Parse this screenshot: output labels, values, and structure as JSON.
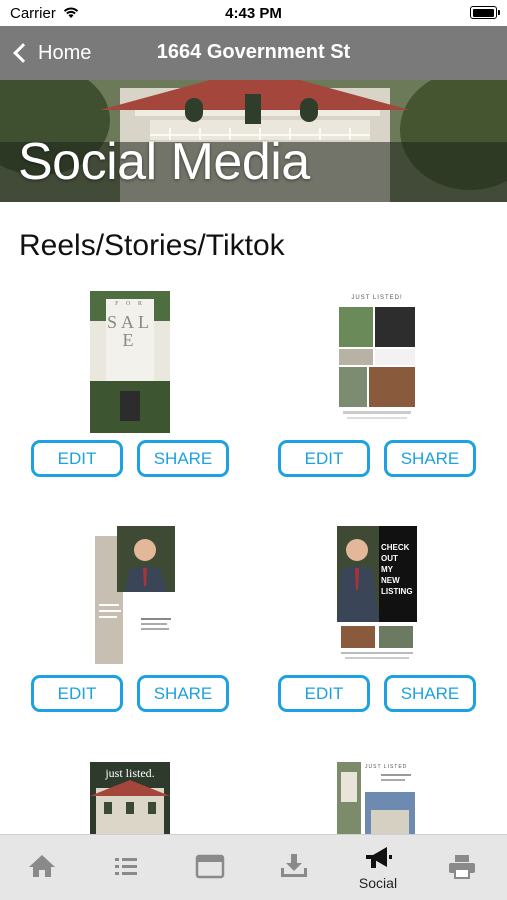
{
  "status_bar": {
    "carrier": "Carrier",
    "time": "4:43 PM",
    "battery_level": 1.0
  },
  "nav": {
    "back_label": "Home",
    "title": "1664 Government St"
  },
  "hero": {
    "title": "Social Media"
  },
  "section": {
    "heading": "Reels/Stories/Tiktok"
  },
  "cards": [
    {
      "edit_label": "EDIT",
      "share_label": "SHARE",
      "thumb_text_1": "F O R",
      "thumb_text_2": "SALE"
    },
    {
      "edit_label": "EDIT",
      "share_label": "SHARE",
      "thumb_text_1": "JUST LISTED!"
    },
    {
      "edit_label": "EDIT",
      "share_label": "SHARE"
    },
    {
      "edit_label": "EDIT",
      "share_label": "SHARE",
      "thumb_text_1": "CHECK OUT MY NEW LISTING"
    },
    {
      "thumb_text_1": "just listed."
    },
    {
      "thumb_text_1": "JUST LISTED"
    }
  ],
  "tab_bar": {
    "tabs": [
      {
        "icon": "home-icon",
        "label": ""
      },
      {
        "icon": "list-icon",
        "label": ""
      },
      {
        "icon": "browser-icon",
        "label": ""
      },
      {
        "icon": "download-icon",
        "label": ""
      },
      {
        "icon": "megaphone-icon",
        "label": "Social"
      },
      {
        "icon": "printer-icon",
        "label": ""
      }
    ],
    "active_index": 4
  },
  "colors": {
    "accent": "#1da1e0",
    "nav_bg": "#7a7a7a",
    "tab_bg": "#e6e6e6"
  }
}
